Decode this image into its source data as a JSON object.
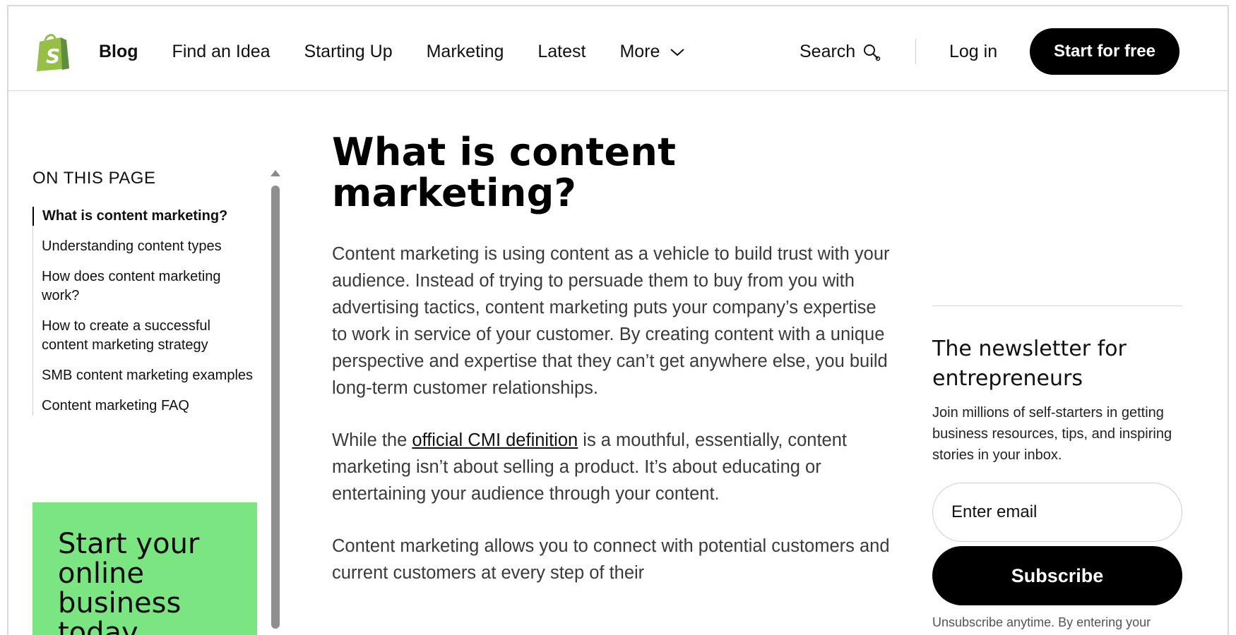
{
  "header": {
    "logo_icon": "shopify-bag-icon",
    "nav": [
      "Blog",
      "Find an Idea",
      "Starting Up",
      "Marketing",
      "Latest",
      "More"
    ],
    "search_label": "Search",
    "login_label": "Log in",
    "start_label": "Start for free"
  },
  "toc": {
    "title": "ON THIS PAGE",
    "items": [
      "What is content marketing?",
      "Understanding content types",
      "How does content marketing work?",
      "How to create a successful content marketing strategy",
      "SMB content marketing examples",
      "Content marketing FAQ"
    ]
  },
  "promo": {
    "text": "Start your online business today"
  },
  "article": {
    "title": "What is content marketing?",
    "p1": "Content marketing is using content as a vehicle to build trust with your audience. Instead of trying to persuade them to buy from you with advertising tactics, content marketing puts your company’s expertise to work in service of your customer. By creating content with a unique perspective and expertise that they can’t get anywhere else, you build long-term customer relationships.",
    "p2_before": "While the ",
    "p2_link": "official CMI definition",
    "p2_after": " is a mouthful, essentially, content marketing isn’t about selling a product. It’s about educating or entertaining your audience through your content.",
    "p3": "Content marketing allows you to connect with potential customers and current customers at every step of their"
  },
  "newsletter": {
    "title": "The newsletter for entrepreneurs",
    "desc": "Join millions of self-starters in getting business resources, tips, and inspiring stories in your inbox.",
    "email_placeholder": "Enter email",
    "subscribe_label": "Subscribe",
    "fine_print": "Unsubscribe anytime. By entering your"
  },
  "colors": {
    "accent_green": "#7be681",
    "logo_green": "#95bf47",
    "button_black": "#000000"
  }
}
